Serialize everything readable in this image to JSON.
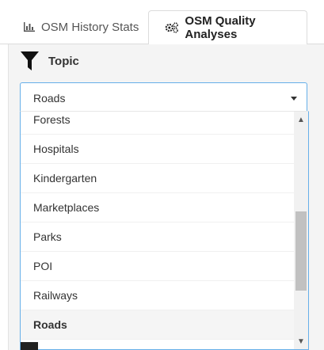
{
  "tabs": [
    {
      "label": "OSM History Stats",
      "icon": "bar-chart-icon",
      "active": false
    },
    {
      "label": "OSM Quality Analyses",
      "icon": "gears-icon",
      "active": true
    }
  ],
  "topic": {
    "label": "Topic",
    "icon": "filter-icon"
  },
  "select": {
    "value": "Roads",
    "options": [
      "Forests",
      "Hospitals",
      "Kindergarten",
      "Marketplaces",
      "Parks",
      "POI",
      "Railways",
      "Roads"
    ],
    "selected": "Roads"
  },
  "colors": {
    "focus_border": "#66afe9",
    "panel_bg": "#f4f4f4",
    "selected_bg": "#f5f5f5"
  }
}
